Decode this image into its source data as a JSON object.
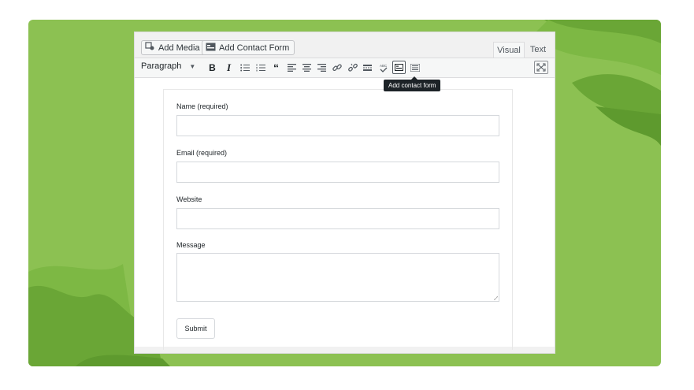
{
  "colors": {
    "background": "#8cc152",
    "wave_dark": "#6aa636",
    "wave_mid": "#7db844"
  },
  "media_buttons": [
    {
      "label": "Add Media",
      "icon": "add-media-icon"
    },
    {
      "label": "Add Contact Form",
      "icon": "contact-form-icon"
    }
  ],
  "tabs": {
    "visual": "Visual",
    "text": "Text",
    "active": "Visual"
  },
  "toolbar": {
    "format_select": "Paragraph",
    "buttons": [
      "bold-icon",
      "italic-icon",
      "bullet-list-icon",
      "numbered-list-icon",
      "blockquote-icon",
      "align-left-icon",
      "align-center-icon",
      "align-right-icon",
      "link-icon",
      "unlink-icon",
      "read-more-icon",
      "spellcheck-icon",
      "add-contact-form-icon",
      "toolbar-toggle-icon"
    ],
    "tooltip": "Add contact form",
    "expand_icon": "fullscreen-icon"
  },
  "form": {
    "fields": [
      {
        "label": "Name (required)",
        "type": "input",
        "value": ""
      },
      {
        "label": "Email (required)",
        "type": "input",
        "value": ""
      },
      {
        "label": "Website",
        "type": "input",
        "value": ""
      },
      {
        "label": "Message",
        "type": "textarea",
        "value": ""
      }
    ],
    "submit_label": "Submit"
  }
}
